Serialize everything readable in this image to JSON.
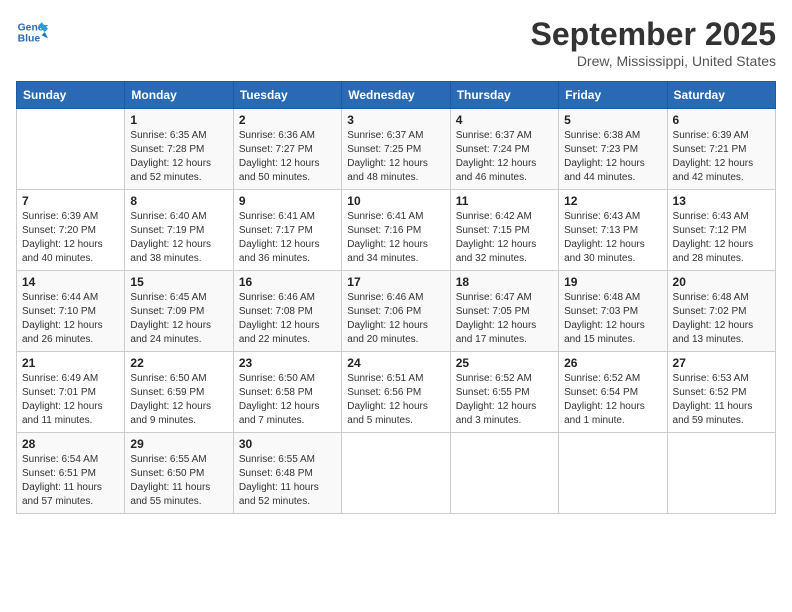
{
  "header": {
    "logo_line1": "General",
    "logo_line2": "Blue",
    "month": "September 2025",
    "location": "Drew, Mississippi, United States"
  },
  "days_of_week": [
    "Sunday",
    "Monday",
    "Tuesday",
    "Wednesday",
    "Thursday",
    "Friday",
    "Saturday"
  ],
  "weeks": [
    [
      {
        "num": "",
        "sunrise": "",
        "sunset": "",
        "daylight": ""
      },
      {
        "num": "1",
        "sunrise": "6:35 AM",
        "sunset": "7:28 PM",
        "daylight": "12 hours and 52 minutes."
      },
      {
        "num": "2",
        "sunrise": "6:36 AM",
        "sunset": "7:27 PM",
        "daylight": "12 hours and 50 minutes."
      },
      {
        "num": "3",
        "sunrise": "6:37 AM",
        "sunset": "7:25 PM",
        "daylight": "12 hours and 48 minutes."
      },
      {
        "num": "4",
        "sunrise": "6:37 AM",
        "sunset": "7:24 PM",
        "daylight": "12 hours and 46 minutes."
      },
      {
        "num": "5",
        "sunrise": "6:38 AM",
        "sunset": "7:23 PM",
        "daylight": "12 hours and 44 minutes."
      },
      {
        "num": "6",
        "sunrise": "6:39 AM",
        "sunset": "7:21 PM",
        "daylight": "12 hours and 42 minutes."
      }
    ],
    [
      {
        "num": "7",
        "sunrise": "6:39 AM",
        "sunset": "7:20 PM",
        "daylight": "12 hours and 40 minutes."
      },
      {
        "num": "8",
        "sunrise": "6:40 AM",
        "sunset": "7:19 PM",
        "daylight": "12 hours and 38 minutes."
      },
      {
        "num": "9",
        "sunrise": "6:41 AM",
        "sunset": "7:17 PM",
        "daylight": "12 hours and 36 minutes."
      },
      {
        "num": "10",
        "sunrise": "6:41 AM",
        "sunset": "7:16 PM",
        "daylight": "12 hours and 34 minutes."
      },
      {
        "num": "11",
        "sunrise": "6:42 AM",
        "sunset": "7:15 PM",
        "daylight": "12 hours and 32 minutes."
      },
      {
        "num": "12",
        "sunrise": "6:43 AM",
        "sunset": "7:13 PM",
        "daylight": "12 hours and 30 minutes."
      },
      {
        "num": "13",
        "sunrise": "6:43 AM",
        "sunset": "7:12 PM",
        "daylight": "12 hours and 28 minutes."
      }
    ],
    [
      {
        "num": "14",
        "sunrise": "6:44 AM",
        "sunset": "7:10 PM",
        "daylight": "12 hours and 26 minutes."
      },
      {
        "num": "15",
        "sunrise": "6:45 AM",
        "sunset": "7:09 PM",
        "daylight": "12 hours and 24 minutes."
      },
      {
        "num": "16",
        "sunrise": "6:46 AM",
        "sunset": "7:08 PM",
        "daylight": "12 hours and 22 minutes."
      },
      {
        "num": "17",
        "sunrise": "6:46 AM",
        "sunset": "7:06 PM",
        "daylight": "12 hours and 20 minutes."
      },
      {
        "num": "18",
        "sunrise": "6:47 AM",
        "sunset": "7:05 PM",
        "daylight": "12 hours and 17 minutes."
      },
      {
        "num": "19",
        "sunrise": "6:48 AM",
        "sunset": "7:03 PM",
        "daylight": "12 hours and 15 minutes."
      },
      {
        "num": "20",
        "sunrise": "6:48 AM",
        "sunset": "7:02 PM",
        "daylight": "12 hours and 13 minutes."
      }
    ],
    [
      {
        "num": "21",
        "sunrise": "6:49 AM",
        "sunset": "7:01 PM",
        "daylight": "12 hours and 11 minutes."
      },
      {
        "num": "22",
        "sunrise": "6:50 AM",
        "sunset": "6:59 PM",
        "daylight": "12 hours and 9 minutes."
      },
      {
        "num": "23",
        "sunrise": "6:50 AM",
        "sunset": "6:58 PM",
        "daylight": "12 hours and 7 minutes."
      },
      {
        "num": "24",
        "sunrise": "6:51 AM",
        "sunset": "6:56 PM",
        "daylight": "12 hours and 5 minutes."
      },
      {
        "num": "25",
        "sunrise": "6:52 AM",
        "sunset": "6:55 PM",
        "daylight": "12 hours and 3 minutes."
      },
      {
        "num": "26",
        "sunrise": "6:52 AM",
        "sunset": "6:54 PM",
        "daylight": "12 hours and 1 minute."
      },
      {
        "num": "27",
        "sunrise": "6:53 AM",
        "sunset": "6:52 PM",
        "daylight": "11 hours and 59 minutes."
      }
    ],
    [
      {
        "num": "28",
        "sunrise": "6:54 AM",
        "sunset": "6:51 PM",
        "daylight": "11 hours and 57 minutes."
      },
      {
        "num": "29",
        "sunrise": "6:55 AM",
        "sunset": "6:50 PM",
        "daylight": "11 hours and 55 minutes."
      },
      {
        "num": "30",
        "sunrise": "6:55 AM",
        "sunset": "6:48 PM",
        "daylight": "11 hours and 52 minutes."
      },
      {
        "num": "",
        "sunrise": "",
        "sunset": "",
        "daylight": ""
      },
      {
        "num": "",
        "sunrise": "",
        "sunset": "",
        "daylight": ""
      },
      {
        "num": "",
        "sunrise": "",
        "sunset": "",
        "daylight": ""
      },
      {
        "num": "",
        "sunrise": "",
        "sunset": "",
        "daylight": ""
      }
    ]
  ],
  "labels": {
    "sunrise_prefix": "Sunrise: ",
    "sunset_prefix": "Sunset: ",
    "daylight_prefix": "Daylight: "
  }
}
